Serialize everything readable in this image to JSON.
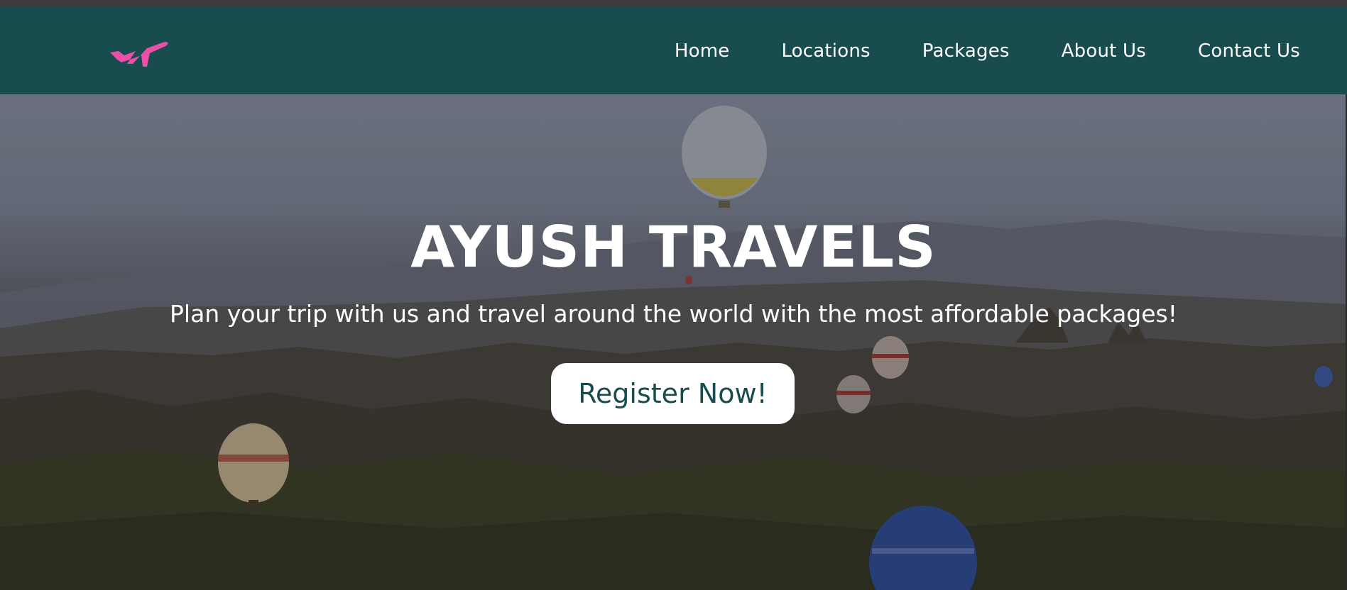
{
  "header": {
    "logo_icon": "airplane-icon",
    "logo_color": "#ec4fa8",
    "background_color": "#184c4f",
    "nav_items": [
      {
        "label": "Home"
      },
      {
        "label": "Locations"
      },
      {
        "label": "Packages"
      },
      {
        "label": "About Us"
      },
      {
        "label": "Contact Us"
      }
    ]
  },
  "hero": {
    "title": "AYUSH TRAVELS",
    "subtitle": "Plan your trip with us and travel around the world with the most affordable packages!",
    "cta_label": "Register Now!",
    "cta_text_color": "#184c4f"
  }
}
